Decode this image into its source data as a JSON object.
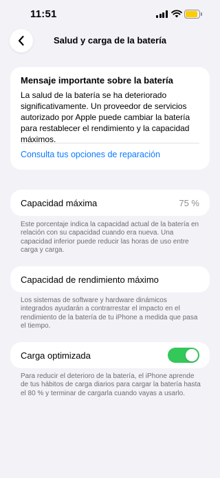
{
  "status_bar": {
    "time": "11:51",
    "icons": [
      "cellular-signal-icon",
      "wifi-icon",
      "battery-icon"
    ],
    "battery_color": "#ffcc00"
  },
  "nav": {
    "back_icon": "chevron-left-icon",
    "title": "Salud y carga de la batería"
  },
  "message": {
    "title": "Mensaje importante sobre la batería",
    "body": "La salud de la batería se ha deteriorado significativamente. Un proveedor de servicios autorizado por Apple puede cambiar la batería para restablecer el rendimiento y la capacidad máximos.",
    "link": "Consulta tus opciones de reparación"
  },
  "max_capacity": {
    "label": "Capacidad máxima",
    "value": "75 %",
    "footnote": "Este porcentaje indica la capacidad actual de la batería en relación con su capacidad cuando era nueva. Una capacidad inferior puede reducir las horas de uso entre carga y carga."
  },
  "peak_performance": {
    "label": "Capacidad de rendimiento máximo",
    "footnote": "Los sistemas de software y hardware dinámicos integrados ayudarán a contrarrestar el impacto en el rendimiento de la batería de tu iPhone a medida que pasa el tiempo."
  },
  "optimized_charging": {
    "label": "Carga optimizada",
    "enabled": true,
    "toggle_color": "#34c759",
    "footnote": "Para reducir el deterioro de la batería, el iPhone aprende de tus hábitos de carga diarios para cargar la batería hasta el 80 % y terminar de cargarla cuando vayas a usarlo."
  },
  "colors": {
    "link": "#0a7aff",
    "background": "#f2f2f7"
  }
}
